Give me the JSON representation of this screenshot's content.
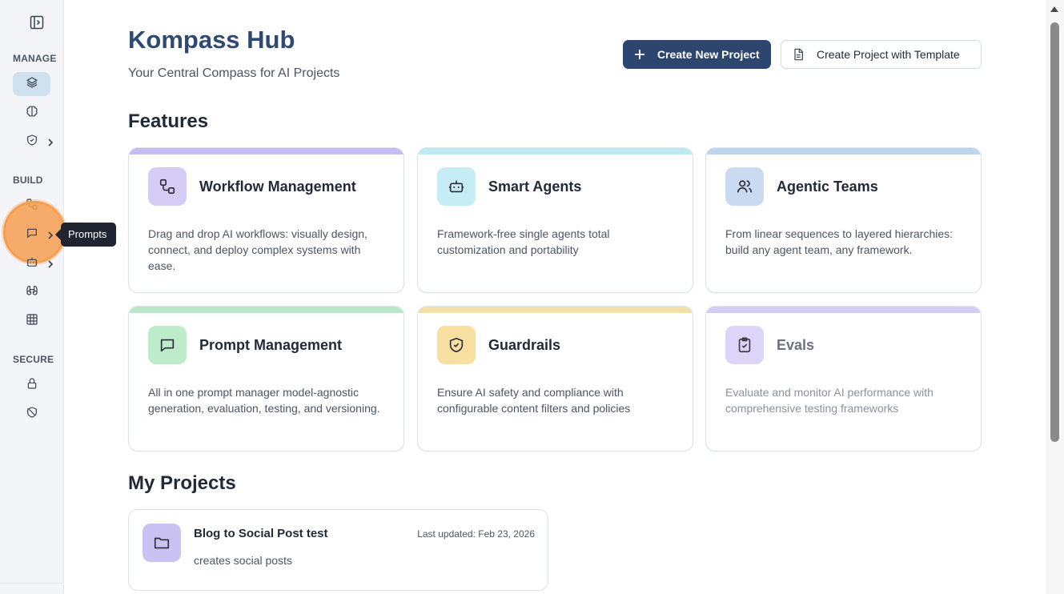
{
  "sidebar": {
    "sections": {
      "manage": "MANAGE",
      "build": "BUILD",
      "secure": "SECURE"
    },
    "items": [
      {
        "icon": "layers-icon",
        "active": true
      },
      {
        "icon": "brain-icon"
      },
      {
        "icon": "shield-check-icon",
        "has_submenu": true
      },
      {
        "icon": "workflow-icon"
      },
      {
        "icon": "message-square-icon",
        "has_submenu": true,
        "tooltip": "Prompts"
      },
      {
        "icon": "bot-icon",
        "has_submenu": true
      },
      {
        "icon": "binoculars-icon"
      },
      {
        "icon": "table-icon"
      },
      {
        "icon": "lock-icon"
      },
      {
        "icon": "shield-off-icon"
      }
    ]
  },
  "tooltip": {
    "text": "Prompts"
  },
  "header": {
    "title": "Kompass Hub",
    "subtitle": "Your Central Compass for AI Projects",
    "create_button": "Create New Project",
    "template_button": "Create Project with Template"
  },
  "features": {
    "heading": "Features",
    "cards": [
      {
        "title": "Workflow Management",
        "description": "Drag and drop AI workflows: visually design, connect, and deploy complex systems with ease.",
        "icon": "workflow-icon",
        "accent": "#c7bdf3",
        "icon_bg": "#d6cdf7"
      },
      {
        "title": "Smart Agents",
        "description": "Framework-free single agents total customization and portability",
        "icon": "bot-icon",
        "accent": "#bfe9f3",
        "icon_bg": "#c6ecf5"
      },
      {
        "title": "Agentic Teams",
        "description": "From linear sequences to layered hierarchies: build any agent team, any framework.",
        "icon": "users-icon",
        "accent": "#bfd4ee",
        "icon_bg": "#c9daf1"
      },
      {
        "title": "Prompt Management",
        "description": "All in one prompt manager model-agnostic generation, evaluation, testing, and versioning.",
        "icon": "message-square-icon",
        "accent": "#b9e8c8",
        "icon_bg": "#bdeccb"
      },
      {
        "title": "Guardrails",
        "description": "Ensure AI safety and compliance with configurable content filters and policies",
        "icon": "shield-check-icon",
        "accent": "#f5dfa8",
        "icon_bg": "#f7dfa1"
      },
      {
        "title": "Evals",
        "description": "Evaluate and monitor AI performance with comprehensive testing frameworks",
        "icon": "clipboard-check-icon",
        "accent": "#d4cdf5",
        "icon_bg": "#dcd5f7",
        "muted": true
      }
    ]
  },
  "projects": {
    "heading": "My Projects",
    "items": [
      {
        "title": "Blog to Social Post test",
        "updated": "Last updated: Feb 23, 2026",
        "description": "creates social posts",
        "icon": "folder-icon"
      }
    ]
  }
}
